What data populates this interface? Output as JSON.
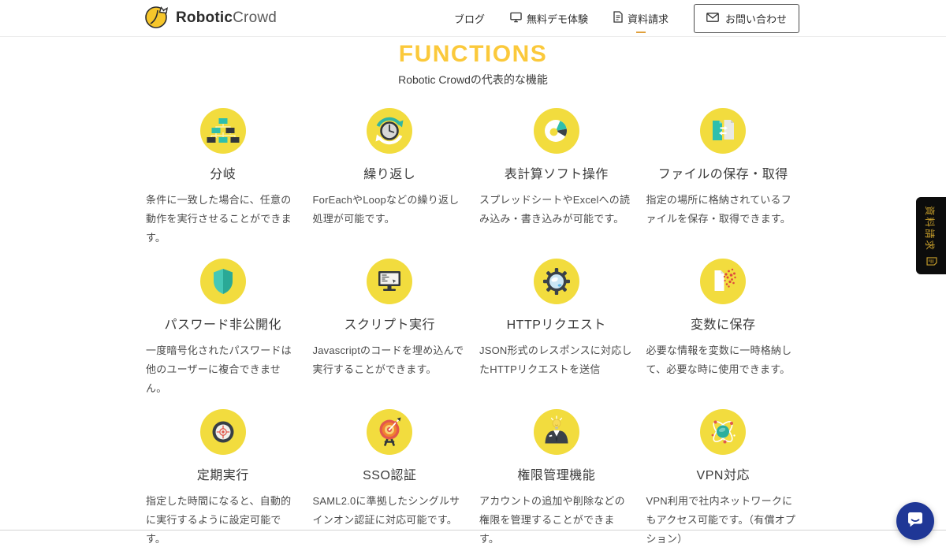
{
  "header": {
    "brand": {
      "bold": "Robotic",
      "light": "Crowd"
    },
    "nav": {
      "blog": "ブログ",
      "demo": "無料デモ体験",
      "docs": "資料請求",
      "contact": "お問い合わせ"
    }
  },
  "hero": {
    "title": "FUNCTIONS",
    "subtitle": "Robotic Crowdの代表的な機能"
  },
  "functions": [
    {
      "icon": "branch-icon",
      "title": "分岐",
      "description": "条件に一致した場合に、任意の動作を実行させることができます。"
    },
    {
      "icon": "loop-clock-icon",
      "title": "繰り返し",
      "description": "ForEachやLoopなどの繰り返し処理が可能です。"
    },
    {
      "icon": "pie-chart-icon",
      "title": "表計算ソフト操作",
      "description": "スプレッドシートやExcelへの読み込み・書き込みが可能です。"
    },
    {
      "icon": "file-transfer-icon",
      "title": "ファイルの保存・取得",
      "description": "指定の場所に格納されているファイルを保存・取得できます。"
    },
    {
      "icon": "shield-icon",
      "title": "パスワード非公開化",
      "description": "一度暗号化されたパスワードは他のユーザーに複合できません。"
    },
    {
      "icon": "monitor-code-icon",
      "title": "スクリプト実行",
      "description": "Javascriptのコードを埋め込んで実行することができます。"
    },
    {
      "icon": "gear-globe-icon",
      "title": "HTTPリクエスト",
      "description": "JSON形式のレスポンスに対応したHTTPリクエストを送信"
    },
    {
      "icon": "document-dots-icon",
      "title": "変数に保存",
      "description": "必要な情報を変数に一時格納して、必要な時に使用できます。"
    },
    {
      "icon": "crosshair-icon",
      "title": "定期実行",
      "description": "指定した時間になると、自動的に実行するように設定可能です。"
    },
    {
      "icon": "archery-target-icon",
      "title": "SSO認証",
      "description": "SAML2.0に準拠したシングルサインオン認証に対応可能です。"
    },
    {
      "icon": "businessman-icon",
      "title": "権限管理機能",
      "description": "アカウントの追加や削除などの権限を管理することができます。"
    },
    {
      "icon": "atom-globe-icon",
      "title": "VPN対応",
      "description": "VPN利用で社内ネットワークにもアクセス可能です。（有償オプション）"
    }
  ],
  "side_tab": {
    "label": "資料請求"
  },
  "colors": {
    "accent_yellow": "#FBC93B",
    "icon_circle_yellow": "#F2DC3E",
    "teal": "#2FBFAC",
    "dark": "#32373B",
    "red": "#E2574C",
    "chat_blue": "#1F3796",
    "side_tab_bg": "#0C0C0C",
    "side_tab_text": "#C79E2B"
  }
}
